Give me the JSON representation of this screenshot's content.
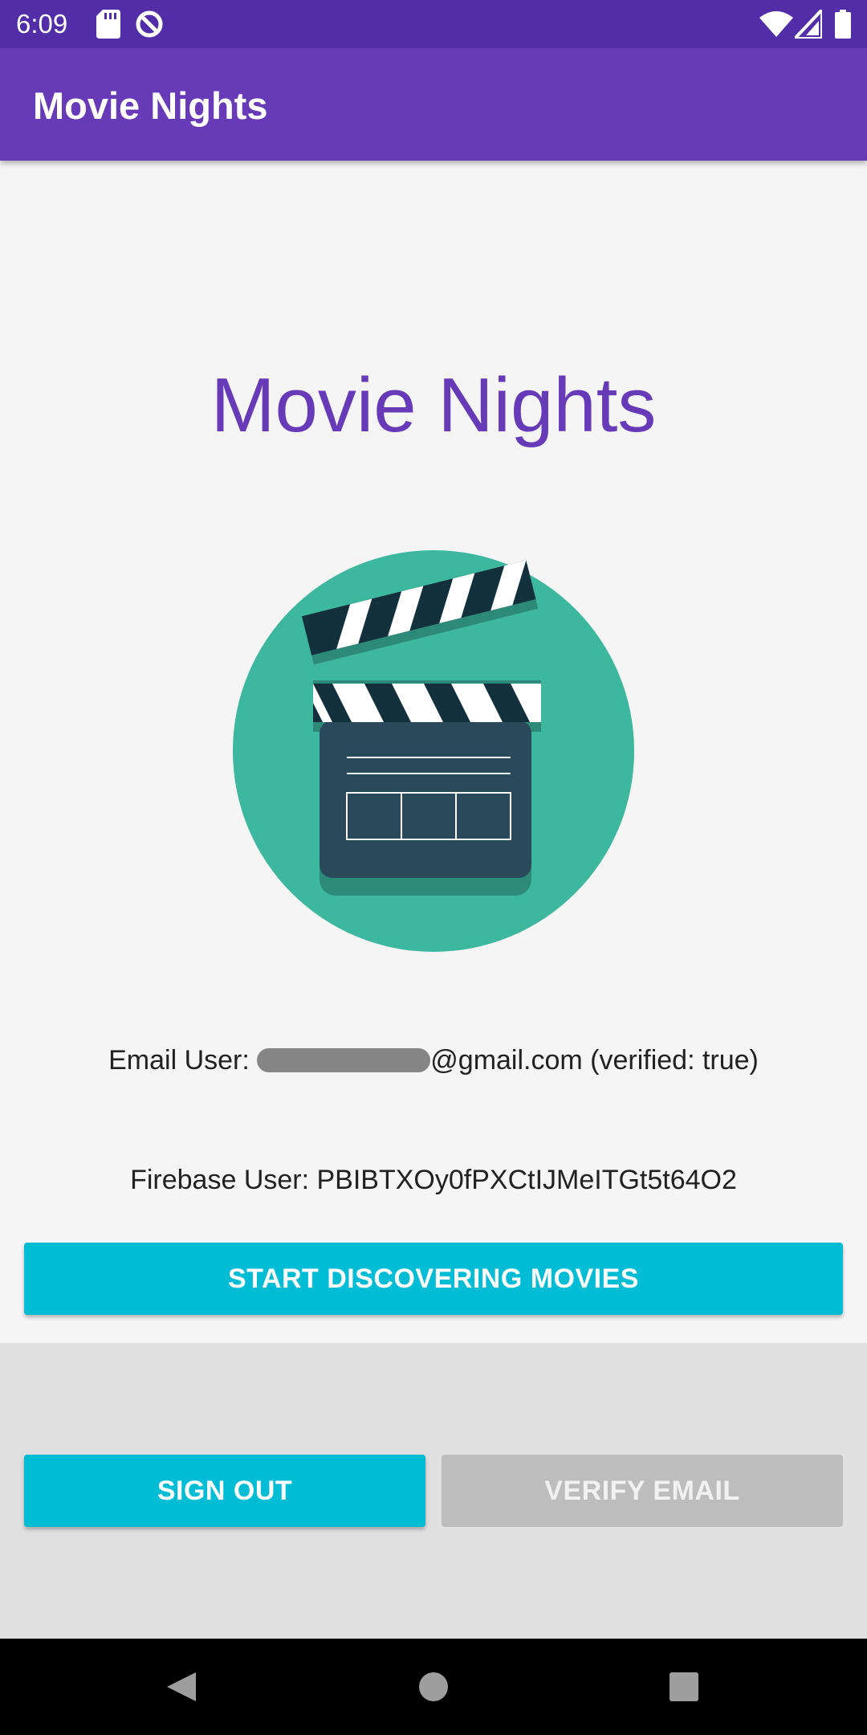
{
  "status_bar": {
    "time": "6:09",
    "icons": [
      "sd-card-icon",
      "sync-icon",
      "wifi-icon",
      "signal-icon",
      "battery-icon"
    ]
  },
  "app_bar": {
    "title": "Movie Nights"
  },
  "main": {
    "headline": "Movie Nights",
    "logo_icon": "clapperboard-icon",
    "email_label": "Email User:",
    "email_suffix": "@gmail.com (verified: true)",
    "firebase_text": "Firebase User: PBIBTXOy0fPXCtIJMeITGt5t64O2",
    "discover_button": "START DISCOVERING MOVIES"
  },
  "bottom": {
    "sign_out_button": "SIGN OUT",
    "verify_email_button": "VERIFY EMAIL"
  },
  "nav_bar": {
    "icons": [
      "back-icon",
      "home-icon",
      "recents-icon"
    ]
  },
  "colors": {
    "status_bar": "#512da8",
    "primary": "#673ab7",
    "accent": "#00bcd4",
    "disabled": "#bdbdbd",
    "logo_circle": "#3db89e",
    "clapper_body": "#2a4a5c"
  }
}
